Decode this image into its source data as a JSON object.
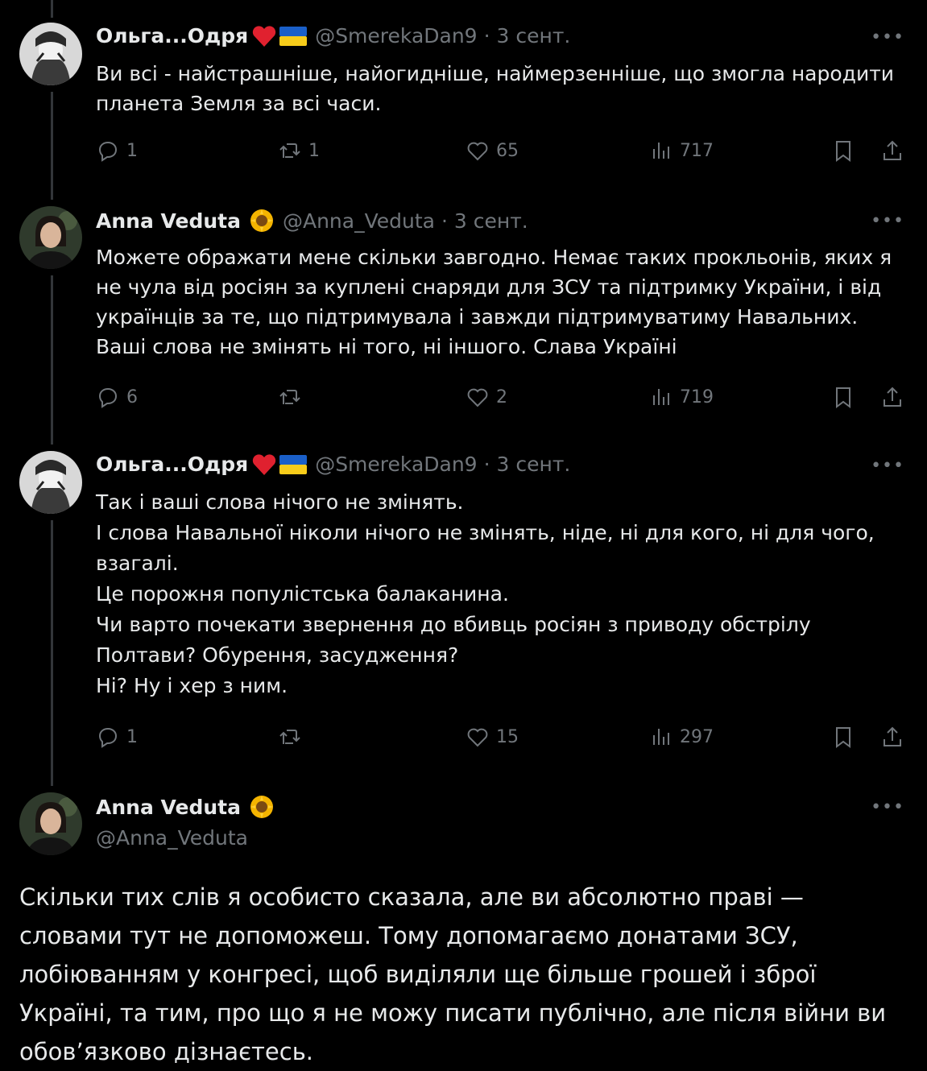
{
  "tweets": [
    {
      "name": "Ольга...Одря",
      "handle": "@SmerekaDan9",
      "time": "3 сент.",
      "text": [
        "Ви всі - найстрашніше, найогидніше, наймерзенніше, що змогла народити планета Земля за всі часи."
      ],
      "replies": "1",
      "reposts": "1",
      "likes": "65",
      "views": "717"
    },
    {
      "name": "Anna Veduta",
      "handle": "@Anna_Veduta",
      "time": "3 сент.",
      "text": [
        "Можете ображати мене скільки завгодно. Немає таких прокльонів, яких я не чула від росіян за куплені снаряди для ЗСУ та підтримку України, і від українців за те, що підтримувала і завжди підтримуватиму Навальних. Ваші слова не змінять ні того, ні іншого. Слава Україні"
      ],
      "replies": "6",
      "reposts": "",
      "likes": "2",
      "views": "719"
    },
    {
      "name": "Ольга...Одря",
      "handle": "@SmerekaDan9",
      "time": "3 сент.",
      "text": [
        "Так і ваші слова нічого не змінять.",
        "І слова Навальної ніколи нічого не змінять, ніде, ні для кого, ні для чого, взагалі.",
        "Це порожня популістська балаканина.",
        "Чи варто почекати звернення до вбивць росіян з приводу обстрілу Полтави? Обурення,  засудження?",
        "Ні? Ну і хер з ним."
      ],
      "replies": "1",
      "reposts": "",
      "likes": "15",
      "views": "297"
    }
  ],
  "main": {
    "name": "Anna Veduta",
    "handle": "@Anna_Veduta",
    "text": "Скільки тих слів я особисто сказала, але ви абсолютно праві — словами тут не допоможеш. Тому допомагаємо донатами ЗСУ, лобіюванням у конгресі, щоб виділяли ще більше грошей і зброї Україні, та тим, про що я не можу писати публічно, але після війни ви обов’язково дізнаєтесь."
  },
  "dot": "·",
  "more_label": "•••",
  "colors": {
    "background": "#000000",
    "text": "#e7e9ea",
    "muted": "#71767b",
    "line": "#333639"
  }
}
